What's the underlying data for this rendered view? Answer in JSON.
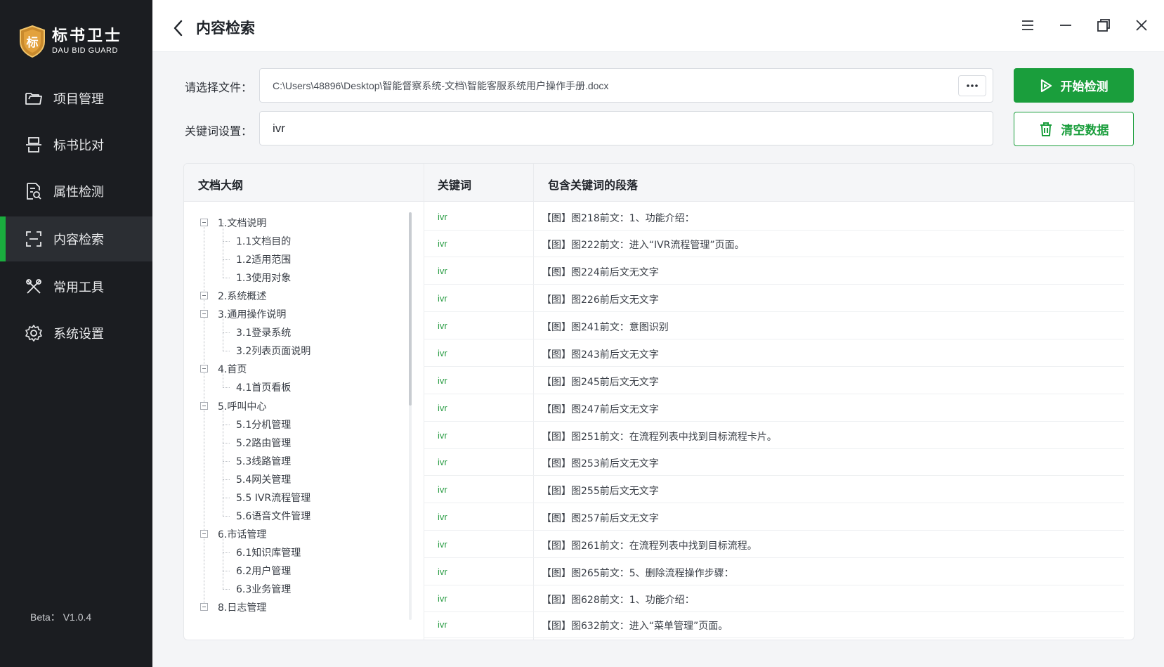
{
  "app": {
    "name_cn": "标书卫士",
    "name_en": "DAU BID GUARD",
    "logo_char": "标",
    "version": "Beta： V1.0.4"
  },
  "sidebar": {
    "items": [
      {
        "label": "项目管理",
        "icon": "folder-icon"
      },
      {
        "label": "标书比对",
        "icon": "compare-icon"
      },
      {
        "label": "属性检测",
        "icon": "document-search-icon"
      },
      {
        "label": "内容检索",
        "icon": "scan-icon",
        "active": true
      },
      {
        "label": "常用工具",
        "icon": "tools-icon"
      },
      {
        "label": "系统设置",
        "icon": "gear-icon"
      }
    ]
  },
  "header": {
    "title": "内容检索"
  },
  "form": {
    "file_label": "请选择文件：",
    "file_value": "C:\\Users\\48896\\Desktop\\智能督察系统-文档\\智能客服系统用户操作手册.docx",
    "keyword_label": "关键词设置：",
    "keyword_value": "ivr",
    "start_label": "开始检测",
    "clear_label": "清空数据"
  },
  "colors": {
    "accent": "#1a9e3c",
    "sidebar_bg": "#1b1d21",
    "keyword": "#2a9d45"
  },
  "table": {
    "headers": [
      "文档大纲",
      "关键词",
      "包含关键词的段落"
    ],
    "outline": [
      {
        "label": "1.文档说明",
        "level": 0
      },
      {
        "label": "1.1文档目的",
        "level": 1
      },
      {
        "label": "1.2适用范围",
        "level": 1
      },
      {
        "label": "1.3使用对象",
        "level": 1
      },
      {
        "label": "2.系统概述",
        "level": 0
      },
      {
        "label": "3.通用操作说明",
        "level": 0
      },
      {
        "label": "3.1登录系统",
        "level": 1
      },
      {
        "label": "3.2列表页面说明",
        "level": 1
      },
      {
        "label": "4.首页",
        "level": 0
      },
      {
        "label": "4.1首页看板",
        "level": 1
      },
      {
        "label": "5.呼叫中心",
        "level": 0
      },
      {
        "label": "5.1分机管理",
        "level": 1
      },
      {
        "label": "5.2路由管理",
        "level": 1
      },
      {
        "label": "5.3线路管理",
        "level": 1
      },
      {
        "label": "5.4网关管理",
        "level": 1
      },
      {
        "label": "5.5 IVR流程管理",
        "level": 1
      },
      {
        "label": "5.6语音文件管理",
        "level": 1
      },
      {
        "label": "6.市话管理",
        "level": 0
      },
      {
        "label": "6.1知识库管理",
        "level": 1
      },
      {
        "label": "6.2用户管理",
        "level": 1
      },
      {
        "label": "6.3业务管理",
        "level": 1
      },
      {
        "label": "8.日志管理",
        "level": 0
      }
    ],
    "rows": [
      {
        "keyword": "ivr",
        "paragraph": "【图】图218前文：1、功能介绍："
      },
      {
        "keyword": "ivr",
        "paragraph": "【图】图222前文：进入“IVR流程管理”页面。"
      },
      {
        "keyword": "ivr",
        "paragraph": "【图】图224前后文无文字"
      },
      {
        "keyword": "ivr",
        "paragraph": "【图】图226前后文无文字"
      },
      {
        "keyword": "ivr",
        "paragraph": "【图】图241前文：意图识别"
      },
      {
        "keyword": "ivr",
        "paragraph": "【图】图243前后文无文字"
      },
      {
        "keyword": "ivr",
        "paragraph": "【图】图245前后文无文字"
      },
      {
        "keyword": "ivr",
        "paragraph": "【图】图247前后文无文字"
      },
      {
        "keyword": "ivr",
        "paragraph": "【图】图251前文：在流程列表中找到目标流程卡片。"
      },
      {
        "keyword": "ivr",
        "paragraph": "【图】图253前后文无文字"
      },
      {
        "keyword": "ivr",
        "paragraph": "【图】图255前后文无文字"
      },
      {
        "keyword": "ivr",
        "paragraph": "【图】图257前后文无文字"
      },
      {
        "keyword": "ivr",
        "paragraph": "【图】图261前文：在流程列表中找到目标流程。"
      },
      {
        "keyword": "ivr",
        "paragraph": "【图】图265前文：5、删除流程操作步骤："
      },
      {
        "keyword": "ivr",
        "paragraph": "【图】图628前文：1、功能介绍："
      },
      {
        "keyword": "ivr",
        "paragraph": "【图】图632前文：进入“菜单管理”页面。"
      }
    ]
  }
}
